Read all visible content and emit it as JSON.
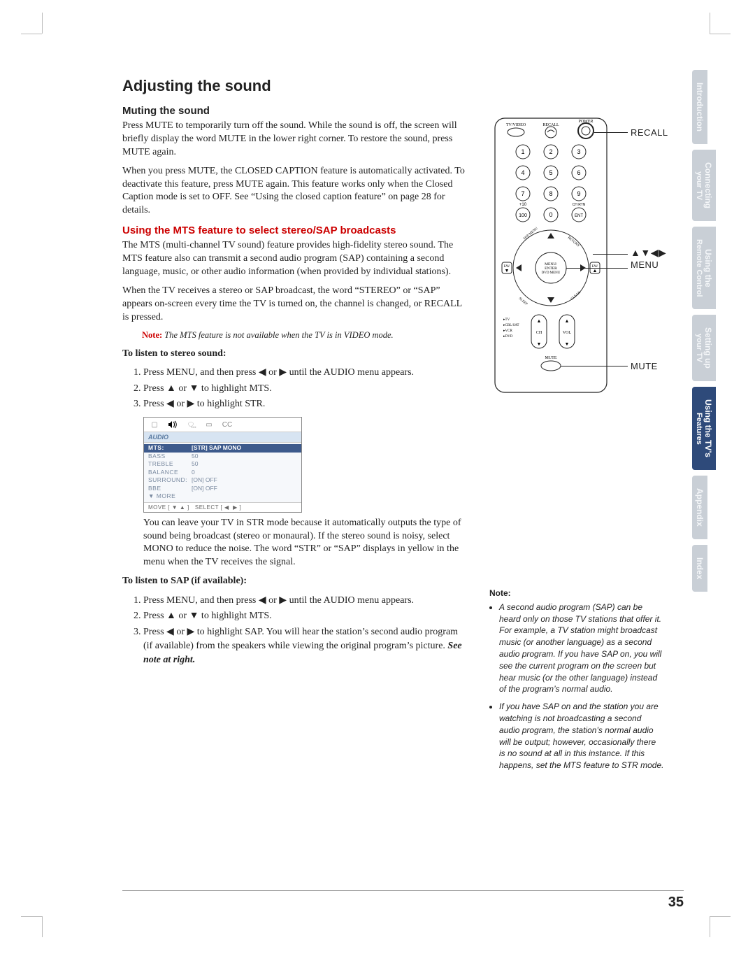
{
  "page_number": "35",
  "section_title": "Adjusting the sound",
  "muting": {
    "heading": "Muting the sound",
    "p1": "Press MUTE to temporarily turn off the sound. While the sound is off, the screen will briefly display the word MUTE in the lower right corner. To restore the sound, press MUTE again.",
    "p2": "When you press MUTE, the CLOSED CAPTION feature is automatically activated. To deactivate this feature, press MUTE again. This feature works only when the Closed Caption mode is set to OFF. See “Using the closed caption feature” on page 28 for details."
  },
  "mts": {
    "heading": "Using the MTS feature to select stereo/SAP broadcasts",
    "p1": "The MTS (multi-channel TV sound) feature provides high-fidelity stereo sound. The MTS feature also can transmit a second audio program (SAP) containing a second language, music, or other audio information (when provided by individual stations).",
    "p2": "When the TV receives a stereo or SAP broadcast, the word “STEREO” or “SAP” appears on-screen every time the TV is turned on, the channel is changed, or RECALL is pressed.",
    "note_label": "Note:",
    "note_text": " The MTS feature is not available when the TV is in VIDEO mode.",
    "stereo_heading": "To listen to stereo sound:",
    "stereo_steps": [
      "Press MENU, and then press ◀ or ▶ until the AUDIO menu appears.",
      "Press ▲ or ▼ to highlight MTS.",
      "Press ◀ or ▶ to highlight STR."
    ],
    "after_osd": "You can leave your TV in STR mode because it automatically outputs the type of sound being broadcast (stereo or monaural). If the stereo sound is noisy, select MONO to reduce the noise. The word “STR” or “SAP” displays in yellow in the menu when the TV receives the signal.",
    "sap_heading": "To listen to SAP (if available):",
    "sap_step1": "Press MENU, and then press ◀ or ▶ until the AUDIO menu appears.",
    "sap_step2": "Press ▲ or ▼ to highlight MTS.",
    "sap_step3_a": "Press ◀ or ▶ to highlight SAP. You will hear the station’s second audio program (if available) from the speakers while viewing the original program’s picture. ",
    "sap_step3_b": "See note at right."
  },
  "osd": {
    "title": "AUDIO",
    "rows": [
      {
        "k": "MTS:",
        "v": "[STR] SAP MONO",
        "hl": true
      },
      {
        "k": "BASS",
        "v": "50"
      },
      {
        "k": "TREBLE",
        "v": "50"
      },
      {
        "k": "BALANCE",
        "v": "0"
      },
      {
        "k": "SURROUND:",
        "v": "[ON] OFF"
      },
      {
        "k": "BBE",
        "v": "[ON] OFF"
      },
      {
        "k": "▼ MORE",
        "v": ""
      }
    ],
    "foot": "MOVE [ ▼ ▲ ]   SELECT [ ◀  ▶ ]"
  },
  "remote_labels": {
    "recall": "RECALL",
    "arrows": "▲▼◀▶",
    "menu": "MENU",
    "mute": "MUTE"
  },
  "remote_face": {
    "top_row": [
      "TV/VIDEO",
      "RECALL",
      "POWER"
    ],
    "plus10": "+10",
    "chrtn": "CH RTN",
    "menu_btn": "MENU/\nENTER\nDVD MENU",
    "fav": "FAV",
    "ch": "CH",
    "vol": "VOL",
    "mute": "MUTE",
    "mode": "▸TV\n▸CBL/SAT\n▸VCR\n▸DVD"
  },
  "side_note": {
    "hdr": "Note:",
    "items": [
      "A second audio program (SAP) can be heard only on those TV stations that offer it. For example, a TV station might broadcast music (or another language) as a second audio program. If you have SAP on, you will see the current program on the screen but hear music (or the other language) instead of the program’s normal audio.",
      "If you have SAP on and the station you are watching is not broadcasting a second audio program, the station’s normal audio will be output; however, occasionally there is no sound at all in this instance. If this happens, set the MTS feature to STR mode."
    ]
  },
  "tabs": [
    {
      "l1": "Introduction",
      "l2": ""
    },
    {
      "l1": "Connecting",
      "l2": "your TV"
    },
    {
      "l1": "Using the",
      "l2": "Remote Control"
    },
    {
      "l1": "Setting up",
      "l2": "your TV"
    },
    {
      "l1": "Using the TV’s",
      "l2": "Features"
    },
    {
      "l1": "Appendix",
      "l2": ""
    },
    {
      "l1": "Index",
      "l2": ""
    }
  ],
  "active_tab_index": 4
}
